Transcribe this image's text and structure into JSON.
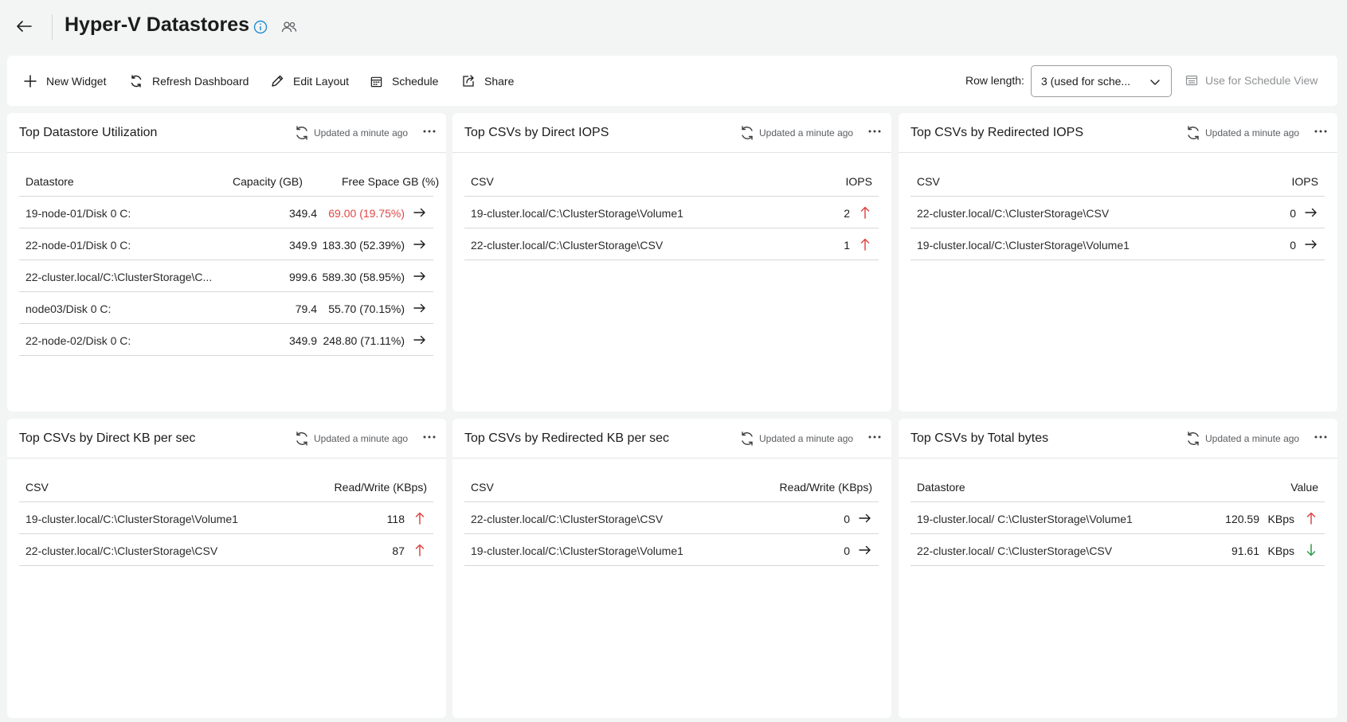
{
  "header": {
    "title": "Hyper-V Datastores"
  },
  "toolbar": {
    "new_widget": "New Widget",
    "refresh_dashboard": "Refresh Dashboard",
    "edit_layout": "Edit Layout",
    "schedule": "Schedule",
    "share": "Share",
    "row_length_label": "Row length:",
    "row_length_value": "3 (used for sche...",
    "use_schedule_view": "Use for Schedule View"
  },
  "updated_text": "Updated a minute ago",
  "colors": {
    "accent": "#1f8ecf",
    "danger": "#e04646",
    "success": "#2e9b47"
  },
  "widgets": [
    {
      "title": "Top Datastore Utilization",
      "columns": [
        "Datastore",
        "Capacity (GB)",
        "Free Space GB (%)"
      ],
      "rows": [
        {
          "name": "19-node-01/Disk 0 C:",
          "capacity": "349.4",
          "free": "69.00 (19.75%)",
          "trend": "arrow-right-icon"
        },
        {
          "name": "22-node-01/Disk 0 C:",
          "capacity": "349.9",
          "free": "183.30 (52.39%)",
          "trend": "arrow-right-icon"
        },
        {
          "name": "22-cluster.local/C:\\ClusterStorage\\C...",
          "capacity": "999.6",
          "free": "589.30 (58.95%)",
          "trend": "arrow-right-icon"
        },
        {
          "name": "node03/Disk 0 C:",
          "capacity": "79.4",
          "free": "55.70 (70.15%)",
          "trend": "arrow-right-icon"
        },
        {
          "name": "22-node-02/Disk 0 C:",
          "capacity": "349.9",
          "free": "248.80 (71.11%)",
          "trend": "arrow-right-icon"
        }
      ]
    },
    {
      "title": "Top CSVs by Direct IOPS",
      "columns": [
        "CSV",
        "IOPS"
      ],
      "rows": [
        {
          "name": "19-cluster.local/C:\\ClusterStorage\\Volume1",
          "value": "2",
          "trend": "arrow-up-icon"
        },
        {
          "name": "22-cluster.local/C:\\ClusterStorage\\CSV",
          "value": "1",
          "trend": "arrow-up-icon"
        }
      ]
    },
    {
      "title": "Top CSVs by Redirected IOPS",
      "columns": [
        "CSV",
        "IOPS"
      ],
      "rows": [
        {
          "name": "22-cluster.local/C:\\ClusterStorage\\CSV",
          "value": "0",
          "trend": "arrow-right-icon"
        },
        {
          "name": "19-cluster.local/C:\\ClusterStorage\\Volume1",
          "value": "0",
          "trend": "arrow-right-icon"
        }
      ]
    },
    {
      "title": "Top CSVs by Direct KB per sec",
      "columns": [
        "CSV",
        "Read/Write (KBps)"
      ],
      "rows": [
        {
          "name": "19-cluster.local/C:\\ClusterStorage\\Volume1",
          "value": "118",
          "trend": "arrow-up-icon"
        },
        {
          "name": "22-cluster.local/C:\\ClusterStorage\\CSV",
          "value": "87",
          "trend": "arrow-up-icon"
        }
      ]
    },
    {
      "title": "Top CSVs by Redirected KB per sec",
      "columns": [
        "CSV",
        "Read/Write (KBps)"
      ],
      "rows": [
        {
          "name": "22-cluster.local/C:\\ClusterStorage\\CSV",
          "value": "0",
          "trend": "arrow-right-icon"
        },
        {
          "name": "19-cluster.local/C:\\ClusterStorage\\Volume1",
          "value": "0",
          "trend": "arrow-right-icon"
        }
      ]
    },
    {
      "title": "Top CSVs by Total bytes",
      "columns": [
        "Datastore",
        "Value"
      ],
      "rows": [
        {
          "name": "19-cluster.local/ C:\\ClusterStorage\\Volume1",
          "value": "120.59",
          "unit": "KBps",
          "trend": "arrow-up-icon"
        },
        {
          "name": "22-cluster.local/ C:\\ClusterStorage\\CSV",
          "value": "91.61",
          "unit": "KBps",
          "trend": "arrow-down-icon"
        }
      ]
    }
  ]
}
